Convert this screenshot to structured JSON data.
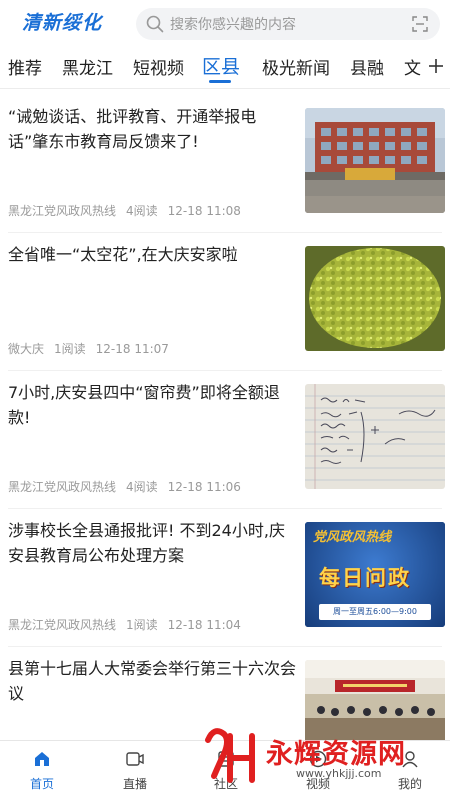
{
  "header": {
    "logo_text": "清新绥化",
    "search_placeholder": "搜索你感兴趣的内容"
  },
  "tabs": [
    {
      "label": "推荐"
    },
    {
      "label": "黑龙江"
    },
    {
      "label": "短视频"
    },
    {
      "label": "区县",
      "active": true
    },
    {
      "label": "极光新闻"
    },
    {
      "label": "县融"
    },
    {
      "label": "文"
    }
  ],
  "news": [
    {
      "title": "“诫勉谈话、批评教育、开通举报电话”肇东市教育局反馈来了!",
      "source": "黑龙江党风政风热线",
      "reads": "4阅读",
      "time": "12-18 11:08",
      "thumb": "school-building-photo"
    },
    {
      "title": "全省唯一“太空花”,在大庆安家啦",
      "source": "微大庆",
      "reads": "1阅读",
      "time": "12-18 11:07",
      "thumb": "green-flower-photo"
    },
    {
      "title": "7小时,庆安县四中“窗帘费”即将全额退款!",
      "source": "黑龙江党风政风热线",
      "reads": "4阅读",
      "time": "12-18 11:06",
      "thumb": "handwritten-notebook-photo"
    },
    {
      "title": "涉事校长全县通报批评! 不到24小时,庆安县教育局公布处理方案",
      "source": "黑龙江党风政风热线",
      "reads": "1阅读",
      "time": "12-18 11:04",
      "thumb": "hotline-banner",
      "thumb_text": {
        "line1": "党风政风热线",
        "line2": "每日问政",
        "line3": "周一至周五6:00—9:00"
      }
    },
    {
      "title": "县第十七届人大常委会举行第三十六次会议",
      "thumb": "meeting-room-photo"
    }
  ],
  "bottom_nav": [
    {
      "label": "首页",
      "icon": "home-icon",
      "active": true
    },
    {
      "label": "直播",
      "icon": "live-video-icon"
    },
    {
      "label": "社区",
      "icon": "community-icon"
    },
    {
      "label": "视频",
      "icon": "video-icon"
    },
    {
      "label": "我的",
      "icon": "profile-icon"
    }
  ],
  "watermark": {
    "text": "永辉资源网",
    "url": "www.yhkjjj.com"
  },
  "colors": {
    "accent": "#1a6fd6",
    "watermark": "#e02020"
  }
}
